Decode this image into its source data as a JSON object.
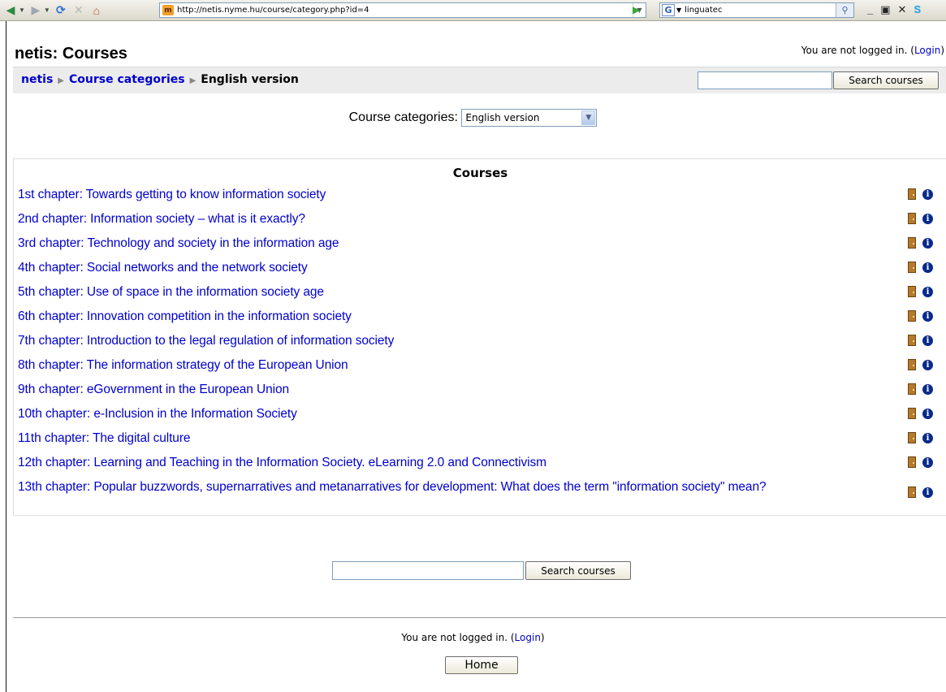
{
  "browser": {
    "url": "http://netis.nyme.hu/course/category.php?id=4",
    "search_value": "linguatec"
  },
  "page": {
    "title": "netis: Courses",
    "login_text": "You are not logged in.",
    "login_link": "Login"
  },
  "breadcrumb": {
    "items": [
      "netis",
      "Course categories",
      "English version"
    ]
  },
  "navbar": {
    "search_button": "Search courses"
  },
  "category_selector": {
    "label": "Course categories:",
    "selected": "English version"
  },
  "courses": {
    "heading": "Courses",
    "items": [
      "1st chapter: Towards getting to know information society",
      "2nd chapter: Information society – what is it exactly?",
      "3rd chapter: Technology and society in the information age",
      "4th chapter: Social networks and the network society",
      "5th chapter: Use of space in the information society age",
      "6th chapter: Innovation competition in the information society",
      "7th chapter: Introduction to the legal regulation of information society",
      "8th chapter: The information strategy of the European Union",
      "9th chapter: eGovernment in the European Union",
      "10th chapter: e-Inclusion in the Information Society",
      "11th chapter: The digital culture",
      "12th chapter: Learning and Teaching in the Information Society. eLearning 2.0 and Connectivism",
      "13th chapter: Popular buzzwords, supernarratives and metanarratives for development: What does the term \"information society\" mean?"
    ]
  },
  "bottom": {
    "search_button": "Search courses",
    "login_text": "You are not logged in.",
    "login_link": "Login",
    "home_button": "Home"
  },
  "icons": {
    "course_enter": "door-icon",
    "course_info": "info-icon"
  },
  "colors": {
    "link": "#0000cc",
    "navbar_bg": "#ececec",
    "info_icon": "#0a2a8a",
    "door_icon": "#b47a2e"
  }
}
